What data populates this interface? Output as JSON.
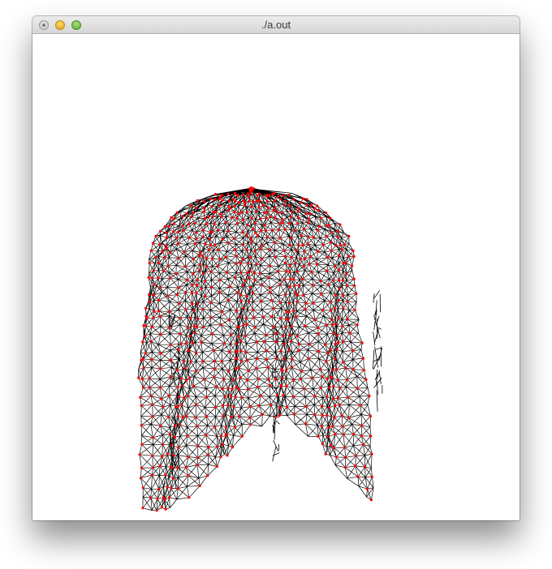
{
  "window": {
    "title": "./a.out"
  },
  "colors": {
    "background": "#ffffff",
    "wire": "#000000",
    "vertex": "#ff0000",
    "titlebar_top": "#ececec",
    "titlebar_bottom": "#d6d6d6"
  },
  "scene": {
    "description_icon": "cloth-wireframe-mesh"
  }
}
